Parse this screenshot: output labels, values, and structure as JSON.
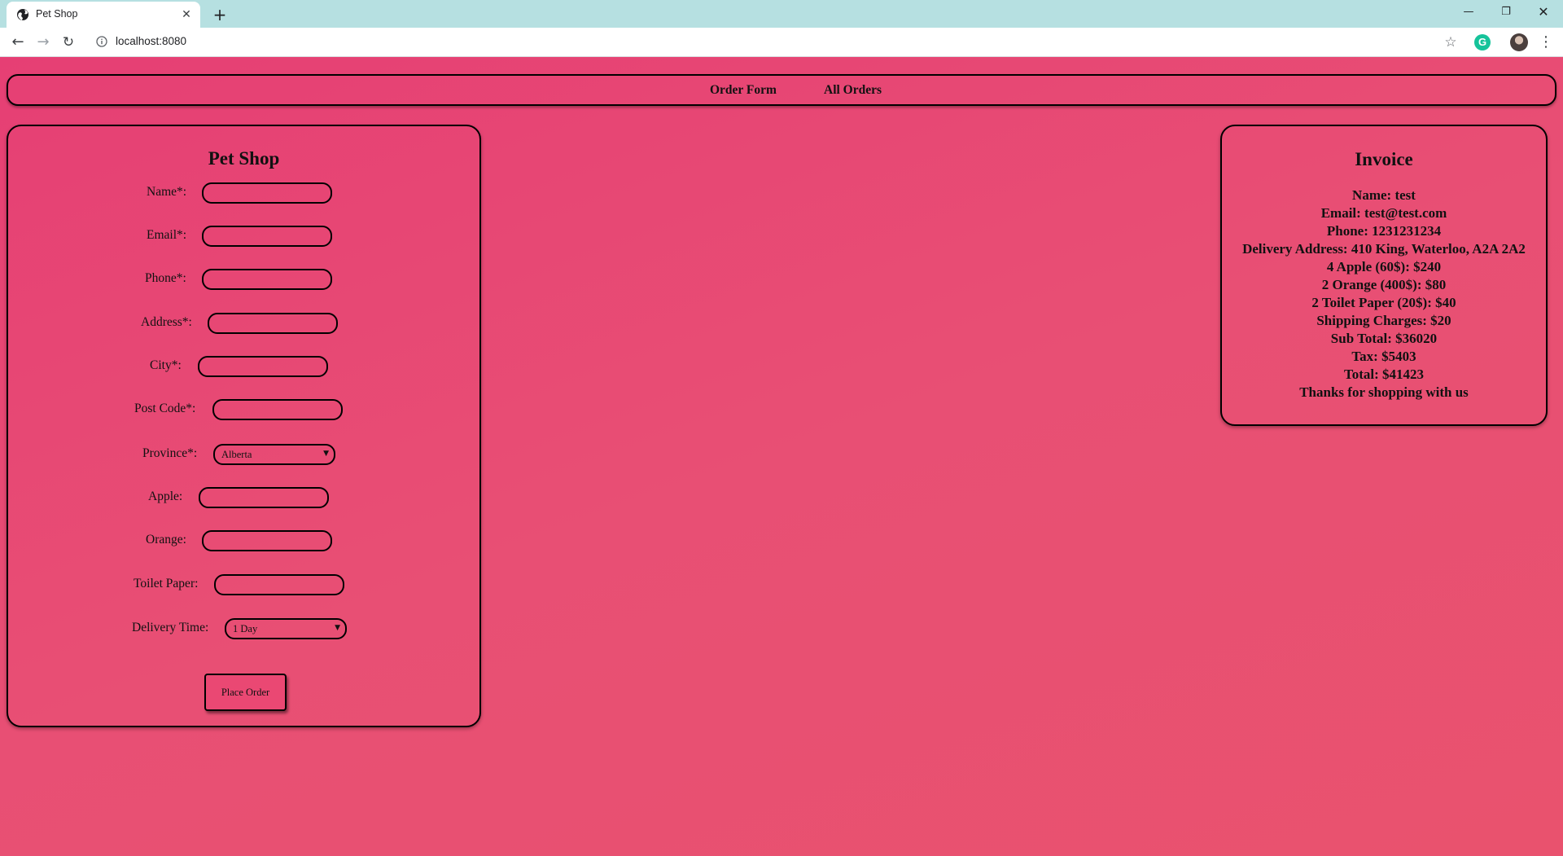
{
  "browser": {
    "tab_title": "Pet Shop",
    "tab_close": "✕",
    "new_tab": "+",
    "url": "localhost:8080"
  },
  "nav": {
    "order_form": "Order Form",
    "all_orders": "All Orders"
  },
  "form": {
    "title": "Pet Shop",
    "fields": {
      "name": {
        "label": "Name*:",
        "value": ""
      },
      "email": {
        "label": "Email*:",
        "value": ""
      },
      "phone": {
        "label": "Phone*:",
        "value": ""
      },
      "address": {
        "label": "Address*:",
        "value": ""
      },
      "city": {
        "label": "City*:",
        "value": ""
      },
      "post_code": {
        "label": "Post Code*:",
        "value": ""
      },
      "province": {
        "label": "Province*:",
        "value": "Alberta"
      },
      "apple": {
        "label": "Apple:",
        "value": ""
      },
      "orange": {
        "label": "Orange:",
        "value": ""
      },
      "toilet_paper": {
        "label": "Toilet Paper:",
        "value": ""
      },
      "delivery_time": {
        "label": "Delivery Time:",
        "value": "1 Day"
      }
    },
    "submit_label": "Place Order"
  },
  "invoice": {
    "title": "Invoice",
    "lines": [
      "Name: test",
      "Email: test@test.com",
      "Phone: 1231231234",
      "Delivery Address: 410 King, Waterloo, A2A 2A2",
      "4 Apple (60$): $240",
      "2 Orange (400$): $80",
      "2 Toilet Paper (20$): $40",
      "Shipping Charges: $20",
      "Sub Total: $36020",
      "Tax: $5403",
      "Total: $41423",
      "Thanks for shopping with us"
    ]
  },
  "colors": {
    "background": "#e8446f",
    "tab_strip": "#b6e0e1",
    "border": "#000000",
    "text": "#111111"
  }
}
